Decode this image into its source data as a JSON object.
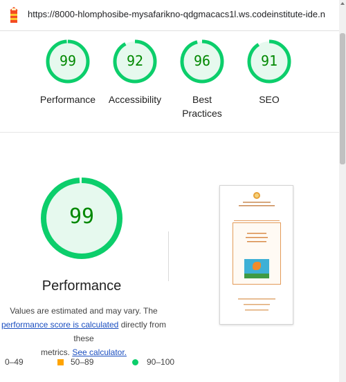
{
  "address_bar": {
    "url": "https://8000-hlomphosibe-mysafarikno-qdgmacacs1l.ws.codeinstitute-ide.net/..."
  },
  "categories": [
    {
      "score": "99",
      "label": "Performance",
      "fraction": 0.99
    },
    {
      "score": "92",
      "label": "Accessibility",
      "fraction": 0.92
    },
    {
      "score": "96",
      "label": "Best Practices",
      "fraction": 0.96
    },
    {
      "score": "91",
      "label": "SEO",
      "fraction": 0.91
    }
  ],
  "performance": {
    "score": "99",
    "fraction": 0.99,
    "title": "Performance",
    "desc_line1": "Values are estimated and may vary. The",
    "desc_link1": "performance score is calculated",
    "desc_mid": " directly from these",
    "desc_line3": "metrics. ",
    "desc_link2": "See calculator."
  },
  "legend": {
    "fail": "0–49",
    "average": "50–89",
    "pass": "90–100"
  },
  "colors": {
    "pass": "#0cce6b",
    "pass_text": "#008800",
    "pass_fill": "#e6f9ee",
    "average": "#ffa400",
    "link": "#1a4ec0"
  }
}
